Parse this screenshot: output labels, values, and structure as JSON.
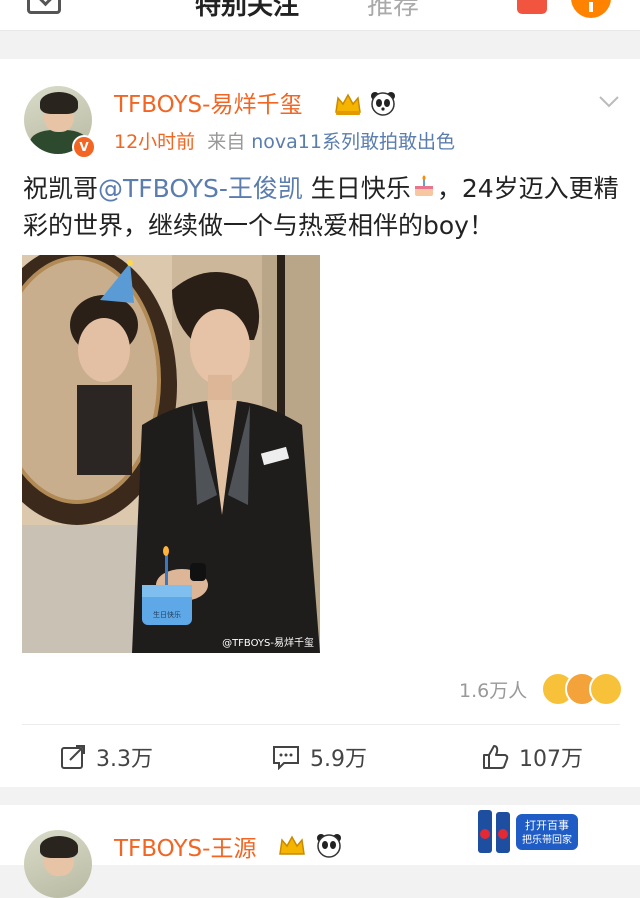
{
  "header": {
    "tabs": [
      {
        "label": "特别关注"
      },
      {
        "label": "推荐"
      }
    ]
  },
  "post": {
    "username": "TFBOYS-易烊千玺",
    "time": "12小时前",
    "from_prefix": "来自",
    "device": "nova11系列敢拍敢出色",
    "text_before": "祝凯哥",
    "mention": "@TFBOYS-王俊凯",
    "text_mid": " 生日快乐",
    "text_after": "，24岁迈入更精彩的世界，继续做一个与热爱相伴的boy！",
    "watermark": "@TFBOYS-易烊千玺",
    "cake_label": "生日快乐",
    "likes_summary": "1.6万人",
    "actions": {
      "repost": "3.3万",
      "comment": "5.9万",
      "like": "107万"
    }
  },
  "next_post": {
    "username": "TFBOYS-王源"
  },
  "ad": {
    "line1": "打开百事",
    "line2": "把乐带回家"
  },
  "colors": {
    "accent": "#f26522",
    "link": "#5b7dae",
    "tab_underline": "#ff8200"
  }
}
